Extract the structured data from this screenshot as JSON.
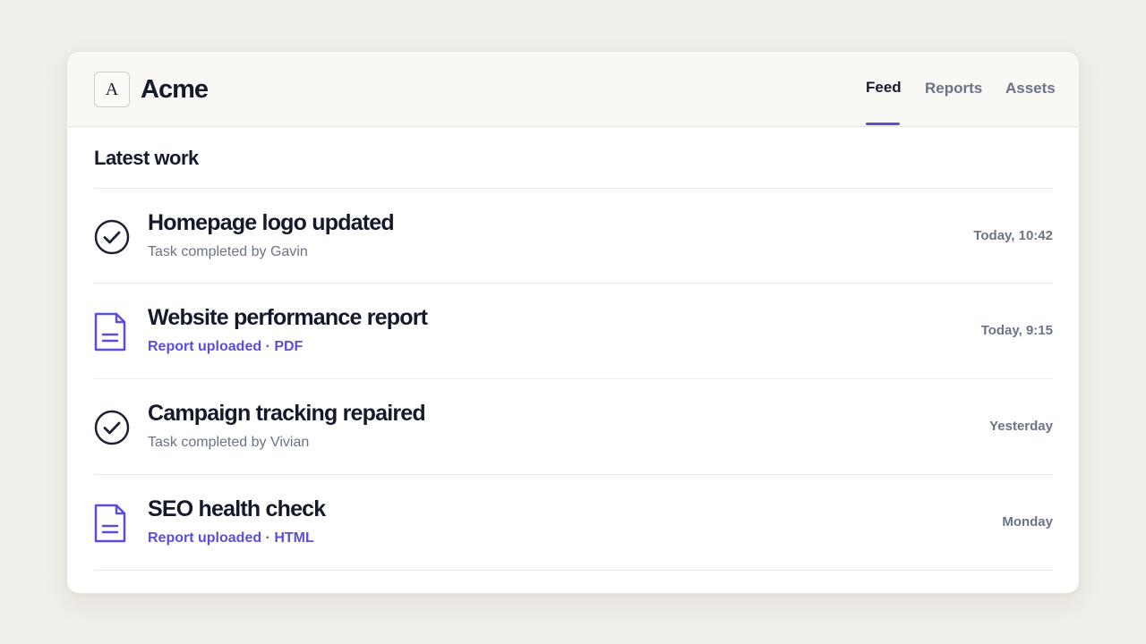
{
  "header": {
    "logo_letter": "A",
    "brand": "Acme",
    "tabs": [
      {
        "label": "Feed",
        "active": true
      },
      {
        "label": "Reports",
        "active": false
      },
      {
        "label": "Assets",
        "active": false
      }
    ]
  },
  "section": {
    "title": "Latest work"
  },
  "feed": [
    {
      "icon": "check-circle-icon",
      "title": "Homepage logo updated",
      "subtitle": "Task completed by Gavin",
      "time": "Today, 10:42"
    },
    {
      "icon": "document-icon",
      "title": "Website performance report",
      "subtitle": "Report uploaded · PDF",
      "time": "Today, 9:15"
    },
    {
      "icon": "check-circle-icon",
      "title": "Campaign tracking repaired",
      "subtitle": "Task completed by Vivian",
      "time": "Yesterday"
    },
    {
      "icon": "document-icon",
      "title": "SEO health check",
      "subtitle": "Report uploaded · HTML",
      "time": "Monday"
    }
  ],
  "colors": {
    "accent": "#5b4fd6",
    "text_primary": "#141a2b",
    "text_muted": "#6b7386",
    "background": "#f1efea"
  }
}
